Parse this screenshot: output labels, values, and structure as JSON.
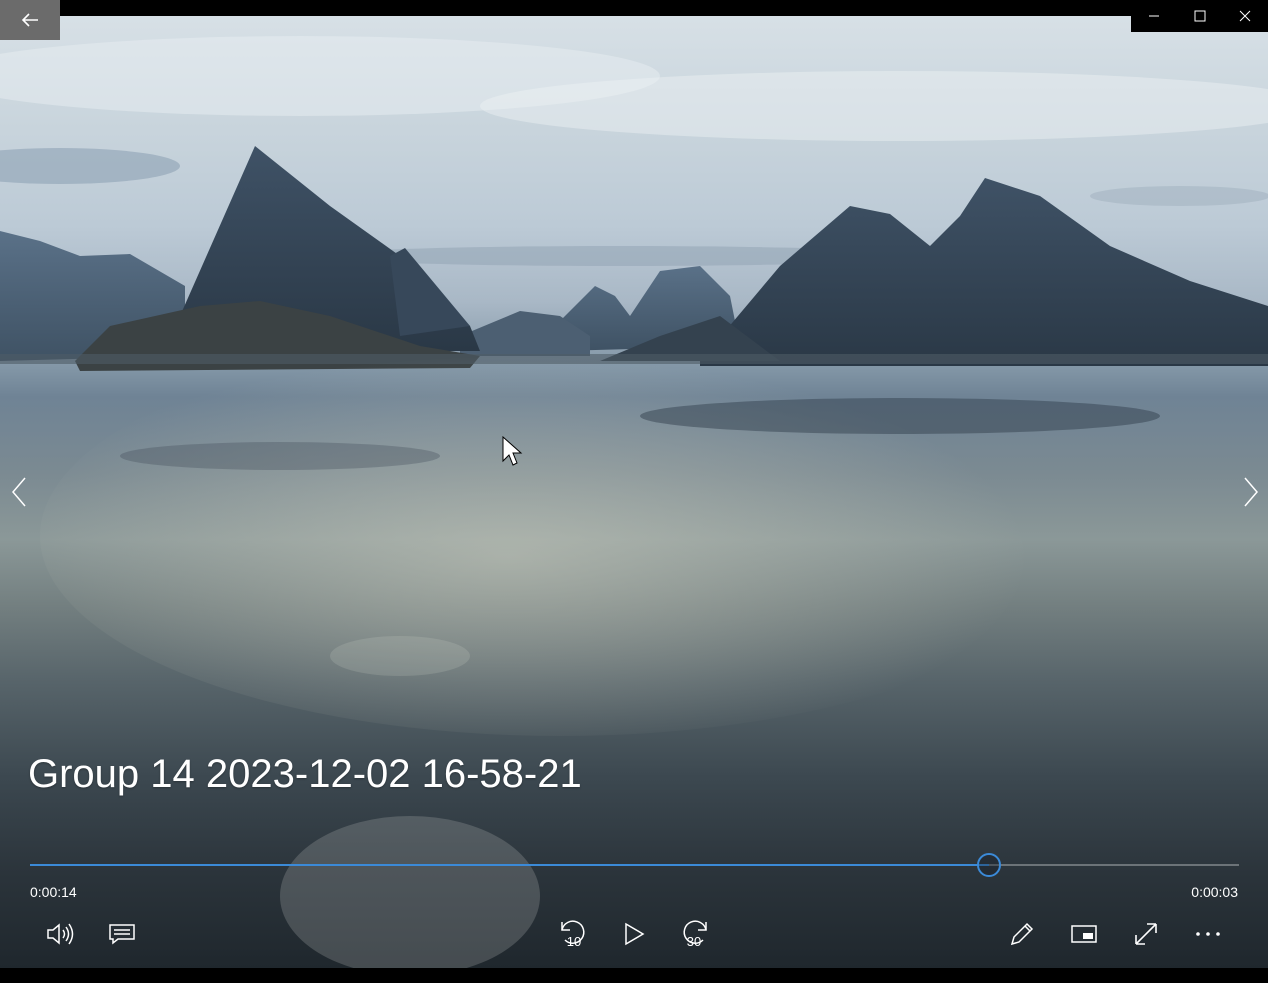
{
  "video": {
    "title": "Group 14 2023-12-02 16-58-21"
  },
  "playback": {
    "elapsed": "0:00:14",
    "remaining": "0:00:03",
    "progress": 0.793
  },
  "controls": {
    "skip_back_seconds": "10",
    "skip_forward_seconds": "30"
  },
  "colors": {
    "accent": "#3b8ad8",
    "track": "#6c7378"
  },
  "icons": {
    "back": "arrow-left-icon",
    "minimize": "minimize-icon",
    "maximize": "maximize-icon",
    "close": "close-icon",
    "previous": "chevron-left-icon",
    "next": "chevron-right-icon",
    "volume": "volume-icon",
    "captions": "captions-icon",
    "skip_back": "skip-back-10-icon",
    "play": "play-icon",
    "skip_forward": "skip-forward-30-icon",
    "edit": "pencil-icon",
    "mini_view": "mini-view-icon",
    "fullscreen": "fullscreen-icon",
    "more": "more-icon"
  }
}
